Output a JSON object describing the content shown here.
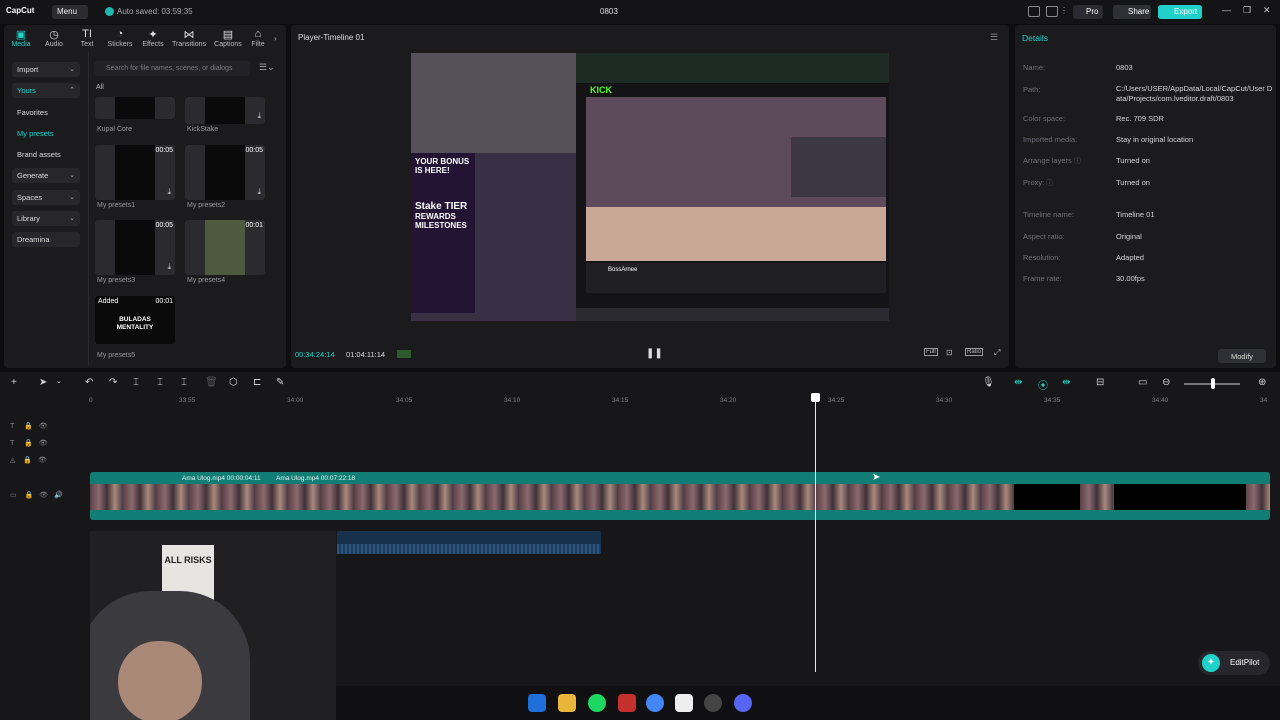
{
  "titlebar": {
    "app": "CapCut",
    "menu": "Menu",
    "autosave": "Auto saved: 03:59:35",
    "project": "0803",
    "pro": "Pro",
    "share": "Share",
    "export": "Export"
  },
  "tabs": [
    {
      "label": "Media",
      "icon": "media-icon"
    },
    {
      "label": "Audio",
      "icon": "audio-icon"
    },
    {
      "label": "Text",
      "icon": "text-icon"
    },
    {
      "label": "Stickers",
      "icon": "stickers-icon"
    },
    {
      "label": "Effects",
      "icon": "effects-icon"
    },
    {
      "label": "Transitions",
      "icon": "transitions-icon"
    },
    {
      "label": "Captions",
      "icon": "captions-icon"
    },
    {
      "label": "Filte",
      "icon": "filters-icon"
    }
  ],
  "leftnav": {
    "import": "Import",
    "yours": "Yours",
    "favorites": "Favorites",
    "my_presets": "My presets",
    "brand_assets": "Brand assets",
    "generate": "Generate",
    "spaces": "Spaces",
    "library": "Library",
    "dreamina": "Dreamina"
  },
  "search": {
    "placeholder": "Search for file names, scenes, or dialogs"
  },
  "media": {
    "all": "All",
    "items": [
      {
        "label": "Kupal Core",
        "duration": ""
      },
      {
        "label": "KickStake",
        "duration": ""
      },
      {
        "label": "My presets1",
        "duration": "00:05"
      },
      {
        "label": "My presets2",
        "duration": "00:05"
      },
      {
        "label": "My presets3",
        "duration": "00:05"
      },
      {
        "label": "My presets4",
        "duration": "00:01"
      },
      {
        "label": "My presets5",
        "duration": "00:01",
        "badge": "Added",
        "text": "BULADAS MENTALITY"
      }
    ]
  },
  "player": {
    "title": "Player-Timeline 01",
    "current": "00:34:24:14",
    "total": "01:04:11:14",
    "full": "Full",
    "ratio": "Ratio"
  },
  "video": {
    "brand": "KICK",
    "ad_line1": "YOUR BONUS IS HERE!",
    "ad_line2": "Stake TIER",
    "ad_line3": "REWARDS MILESTONES",
    "streamer": "BossArnee"
  },
  "details": {
    "heading": "Details",
    "rows": [
      {
        "key": "Name:",
        "value": "0803"
      },
      {
        "key": "Path:",
        "value": "C:/Users/USER/AppData/Local/CapCut/User Data/Projects/com.lveditor.draft/0803"
      },
      {
        "key": "Color space:",
        "value": "Rec. 709 SDR"
      },
      {
        "key": "Imported media:",
        "value": "Stay in original location"
      },
      {
        "key": "Arrange layers",
        "value": "Turned on"
      },
      {
        "key": "Proxy:",
        "value": "Turned on"
      },
      {
        "key": "Timeline name:",
        "value": "Timeline 01"
      },
      {
        "key": "Aspect ratio:",
        "value": "Original"
      },
      {
        "key": "Resolution:",
        "value": "Adapted"
      },
      {
        "key": "Frame rate:",
        "value": "30.00fps"
      }
    ],
    "modify": "Modify"
  },
  "timeline": {
    "ticks": [
      "0",
      "33:55",
      "34:00",
      "34:05",
      "34:10",
      "34:15",
      "34:20",
      "34:25",
      "34:30",
      "34:35",
      "34:40",
      "34"
    ],
    "clip1": "Ama Ulog.mp4  00:00:04:11",
    "clip2": "Ama Ulog.mp4  00:07:22:18"
  },
  "webcam": {
    "poster": "ALL RISKS"
  },
  "editpilot": "EditPilot"
}
